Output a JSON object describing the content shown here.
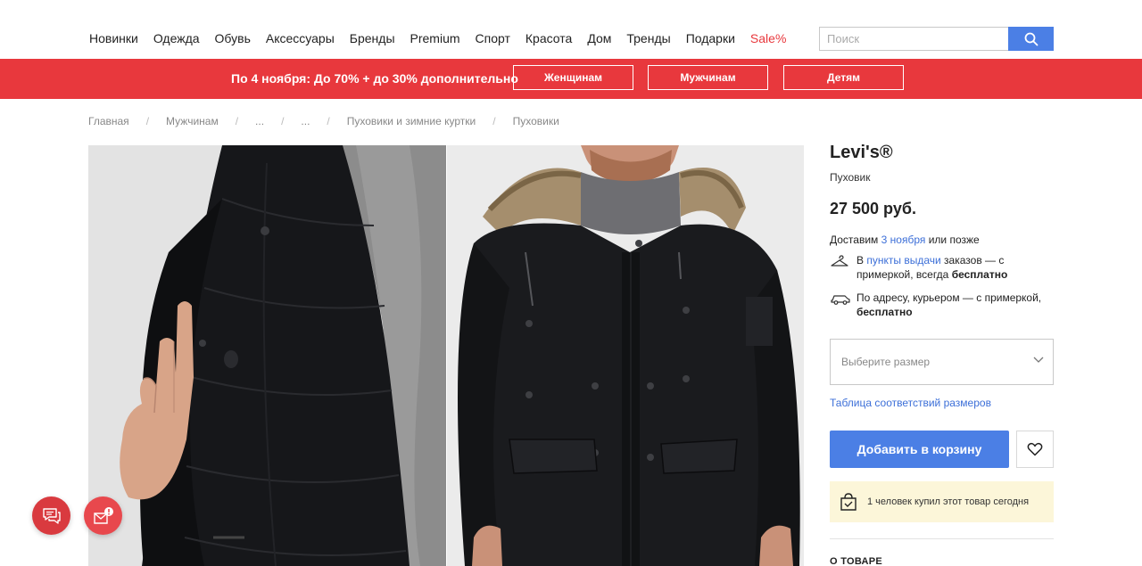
{
  "nav": {
    "items": [
      "Новинки",
      "Одежда",
      "Обувь",
      "Аксессуары",
      "Бренды",
      "Premium",
      "Спорт",
      "Красота",
      "Дом",
      "Тренды",
      "Подарки"
    ],
    "sale": "Sale%",
    "search_placeholder": "Поиск"
  },
  "promo": {
    "text": "По 4 ноября: До 70% + до 30% дополнительно",
    "buttons": [
      "Женщинам",
      "Мужчинам",
      "Детям"
    ]
  },
  "breadcrumbs": [
    "Главная",
    "Мужчинам",
    "...",
    "...",
    "Пуховики и зимние куртки",
    "Пуховики"
  ],
  "product": {
    "brand": "Levi's®",
    "type": "Пуховик",
    "price": "27 500 руб.",
    "delivery_prefix": "Доставим",
    "delivery_date": "3 ноября",
    "delivery_suffix": "или позже",
    "pickup_prefix": "В",
    "pickup_link": "пункты выдачи",
    "pickup_mid": "заказов — с примеркой, всегда",
    "pickup_free": "бесплатно",
    "courier_text": "По адресу, курьером — с примеркой,",
    "courier_free": "бесплатно",
    "size_placeholder": "Выберите размер",
    "size_table": "Таблица соответствий размеров",
    "add_to_cart": "Добавить в корзину",
    "bought_today": "1 человек купил этот товар сегодня",
    "about_heading": "О ТОВАРЕ"
  },
  "colors": {
    "accent_red": "#e8383d",
    "button_blue": "#4b7fe5",
    "link_blue": "#3c6fd8",
    "notice_bg": "#fcf6d9"
  },
  "icons": [
    "search-icon",
    "hanger-icon",
    "courier-car-icon",
    "chevron-down-icon",
    "heart-icon",
    "shopping-bag-check-icon",
    "chat-icon",
    "mail-alert-icon"
  ]
}
